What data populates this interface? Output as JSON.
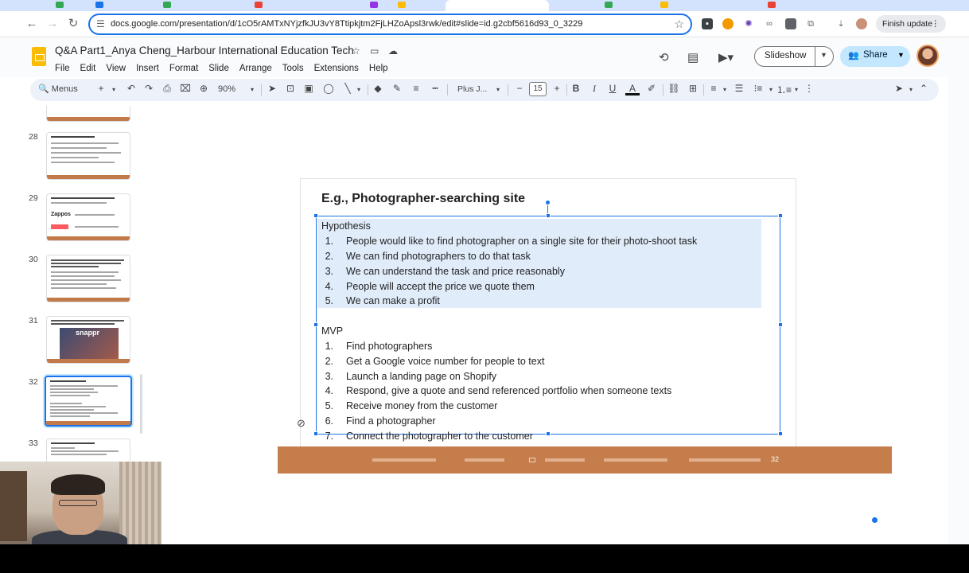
{
  "browser": {
    "url": "docs.google.com/presentation/d/1cO5rAMTxNYjzfkJU3vY8Ttipkjtm2FjLHZoApsl3rwk/edit#slide=id.g2cbf5616d93_0_3229",
    "finish_update_label": "Finish update"
  },
  "doc": {
    "title": "Q&A Part1_Anya Cheng_Harbour International Education Tech",
    "menu": [
      "File",
      "Edit",
      "View",
      "Insert",
      "Format",
      "Slide",
      "Arrange",
      "Tools",
      "Extensions",
      "Help"
    ],
    "slideshow_label": "Slideshow",
    "share_label": "Share"
  },
  "toolbar": {
    "menus_label": "Menus",
    "zoom": "90%",
    "font": "Plus J...",
    "font_size": "15"
  },
  "filmstrip": {
    "numbers": [
      "28",
      "29",
      "30",
      "31",
      "32",
      "33"
    ],
    "selected": "32",
    "thumb31_caption": "snappr"
  },
  "slide": {
    "title": "E.g., Photographer-searching site",
    "hypothesis_heading": "Hypothesis",
    "hypothesis": [
      "People would like to find photographer on a single site for their photo-shoot task",
      "We can find photographers to do that task",
      "We can understand the task and price reasonably",
      "People will accept the price we quote them",
      "We can make a profit"
    ],
    "mvp_heading": "MVP",
    "mvp": [
      "Find photographers",
      "Get a Google voice number for people to text",
      "Launch a landing page on Shopify",
      "Respond, give a quote and send referenced portfolio when someone texts",
      "Receive money from the customer",
      "Find a photographer",
      "Connect the photographer to the customer"
    ],
    "numbers_h": [
      "1.",
      "2.",
      "3.",
      "4.",
      "5."
    ],
    "numbers_m": [
      "1.",
      "2.",
      "3.",
      "4.",
      "5.",
      "6.",
      "7."
    ],
    "page_number": "32"
  },
  "colors": {
    "accent": "#1a73e8",
    "footer_band": "#c47d4b",
    "selection": "#c6dcf6",
    "share": "#c2e7ff"
  }
}
